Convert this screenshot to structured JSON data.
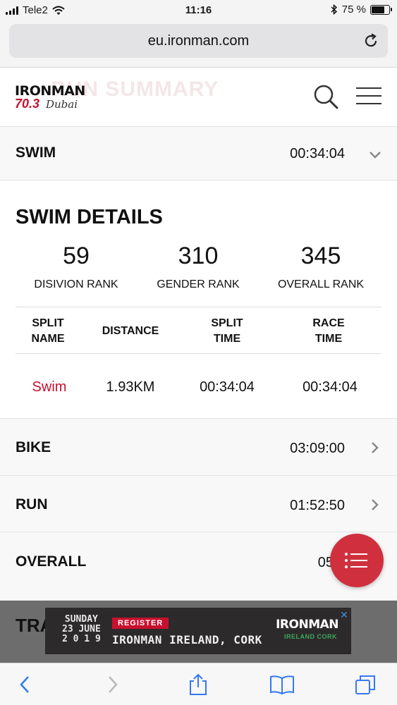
{
  "status_bar": {
    "carrier": "Tele2",
    "time": "11:16",
    "battery_percent": "75 %",
    "battery_level": 0.75
  },
  "browser": {
    "url": "eu.ironman.com"
  },
  "header": {
    "faded_title": "RUN SUMMARY",
    "logo_brand": "IRONMAN",
    "logo_sub": "70.3",
    "logo_city": "Dubai"
  },
  "rows": {
    "swim": {
      "label": "SWIM",
      "time": "00:34:04"
    },
    "bike": {
      "label": "BIKE",
      "time": "03:09:00"
    },
    "run": {
      "label": "RUN",
      "time": "01:52:50"
    },
    "overall": {
      "label": "OVERALL",
      "time": "05"
    }
  },
  "swim_details": {
    "title": "SWIM DETAILS",
    "ranks": [
      {
        "value": "59",
        "label": "DISIVION RANK"
      },
      {
        "value": "310",
        "label": "GENDER RANK"
      },
      {
        "value": "345",
        "label": "OVERALL RANK"
      }
    ],
    "table": {
      "headers": {
        "split_name": [
          "SPLIT",
          "NAME"
        ],
        "distance": [
          "DISTANCE"
        ],
        "split_time": [
          "SPLIT",
          "TIME"
        ],
        "race_time": [
          "RACE",
          "TIME"
        ]
      },
      "rows": [
        {
          "split_name": "Swim",
          "distance": "1.93KM",
          "split_time": "00:34:04",
          "race_time": "00:34:04"
        }
      ]
    }
  },
  "peek_section_text": "TRA",
  "ad": {
    "date_lines": [
      "SUNDAY",
      "23 JUNE",
      "2 0 1 9"
    ],
    "cta": "REGISTER",
    "event": "IRONMAN IRELAND, CORK",
    "brand": "IRONMAN",
    "brand_sub": "IRELAND CORK"
  },
  "colors": {
    "accent_red": "#c8102e",
    "fab_red": "#d0303e",
    "ios_blue": "#3478f6"
  },
  "icons": {
    "reload": "reload-icon",
    "search": "search-icon",
    "menu": "hamburger-icon",
    "chevron_down": "chevron-down-icon",
    "chevron_right": "chevron-right-icon",
    "fab": "list-icon",
    "back": "back-arrow-icon",
    "forward": "forward-arrow-icon",
    "share": "share-icon",
    "bookmarks": "bookmarks-icon",
    "tabs": "tabs-icon"
  }
}
